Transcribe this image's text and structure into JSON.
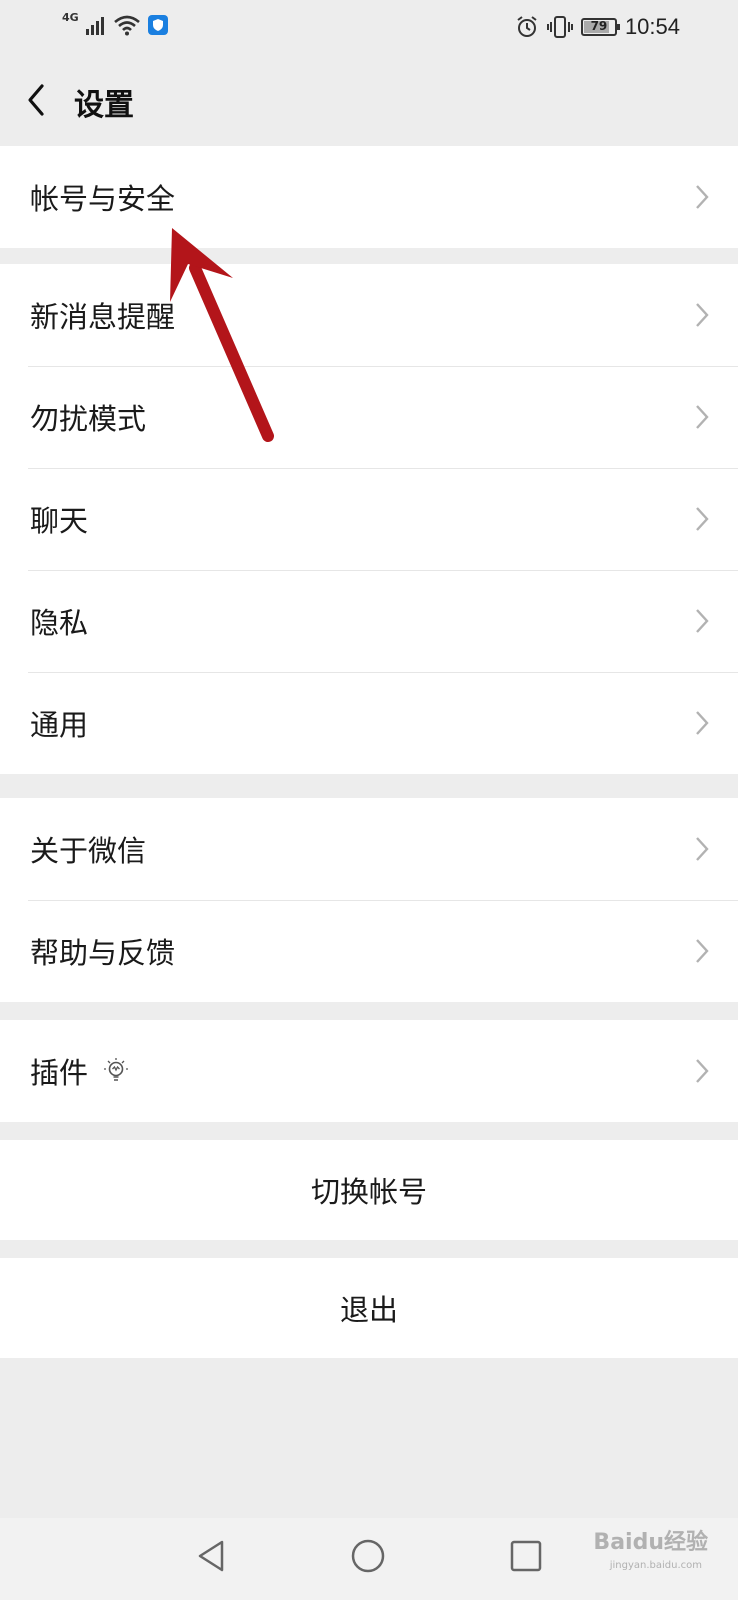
{
  "status_bar": {
    "network": "4G",
    "battery": "79",
    "time": "10:54"
  },
  "header": {
    "title": "设置"
  },
  "groups": {
    "account": [
      "帐号与安全"
    ],
    "main": [
      "新消息提醒",
      "勿扰模式",
      "聊天",
      "隐私",
      "通用"
    ],
    "about": [
      "关于微信",
      "帮助与反馈"
    ],
    "plugins": [
      "插件"
    ]
  },
  "actions": {
    "switch_account": "切换帐号",
    "logout": "退出"
  },
  "watermark": {
    "brand": "Baidu经验",
    "url": "jingyan.baidu.com"
  },
  "colors": {
    "background": "#ededed",
    "annotation_arrow": "#b3151a",
    "security_shield": "#1a7fe0"
  }
}
